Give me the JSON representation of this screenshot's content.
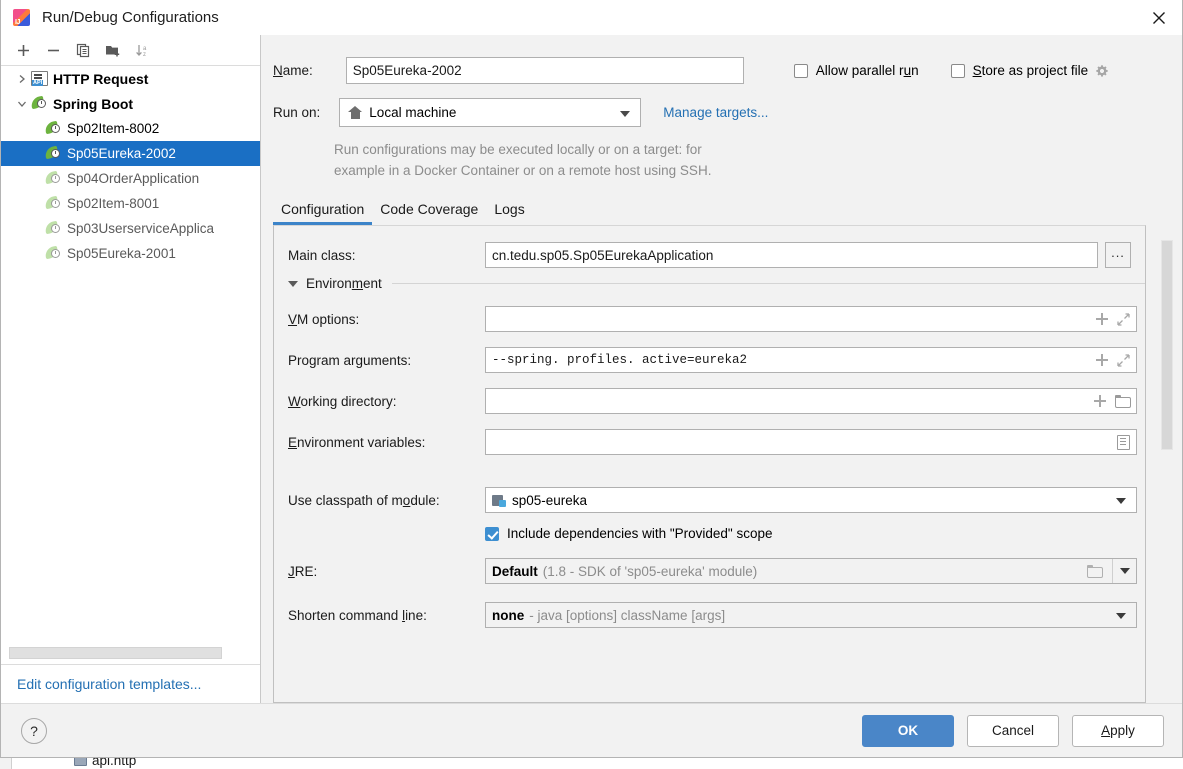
{
  "window": {
    "title": "Run/Debug Configurations",
    "app_icon": "intellij-idea-icon",
    "close_icon": "close-icon"
  },
  "sidebar": {
    "toolbar": [
      {
        "name": "add-configuration-button",
        "icon": "plus-icon"
      },
      {
        "name": "remove-configuration-button",
        "icon": "minus-icon"
      },
      {
        "name": "copy-configuration-button",
        "icon": "copy-icon"
      },
      {
        "name": "new-folder-button",
        "icon": "folder-add-icon"
      },
      {
        "name": "sort-configurations-button",
        "icon": "sort-alphabetical-icon"
      }
    ],
    "tree": [
      {
        "label": "HTTP Request",
        "type": "group",
        "expanded": false,
        "icon": "http-request-icon",
        "selected": false
      },
      {
        "label": "Spring Boot",
        "type": "group",
        "expanded": true,
        "icon": "spring-boot-icon",
        "selected": false
      },
      {
        "label": "Sp02Item-8002",
        "type": "item",
        "icon": "spring-boot-icon",
        "selected": false,
        "dim": false
      },
      {
        "label": "Sp05Eureka-2002",
        "type": "item",
        "icon": "spring-boot-icon",
        "selected": true,
        "dim": false
      },
      {
        "label": "Sp04OrderApplication",
        "type": "item",
        "icon": "spring-boot-icon",
        "selected": false,
        "dim": true
      },
      {
        "label": "Sp02Item-8001",
        "type": "item",
        "icon": "spring-boot-icon",
        "selected": false,
        "dim": true
      },
      {
        "label": "Sp03UserserviceApplica",
        "type": "item",
        "icon": "spring-boot-icon",
        "selected": false,
        "dim": true
      },
      {
        "label": "Sp05Eureka-2001",
        "type": "item",
        "icon": "spring-boot-icon",
        "selected": false,
        "dim": true
      }
    ],
    "edit_templates_link": "Edit configuration templates..."
  },
  "form": {
    "name_label": "Name:",
    "name_value": "Sp05Eureka-2002",
    "allow_parallel_run_label": "Allow parallel run",
    "allow_parallel_run_checked": false,
    "store_as_project_file_label": "Store as project file",
    "store_as_project_file_checked": false,
    "run_on_label": "Run on:",
    "run_on_value": "Local machine",
    "manage_targets_link": "Manage targets...",
    "hint_line1": "Run configurations may be executed locally or on a target: for",
    "hint_line2": "example in a Docker Container or on a remote host using SSH."
  },
  "tabs": [
    {
      "label": "Configuration",
      "active": true
    },
    {
      "label": "Code Coverage",
      "active": false
    },
    {
      "label": "Logs",
      "active": false
    }
  ],
  "configuration": {
    "main_class_label": "Main class:",
    "main_class_value": "cn.tedu.sp05.Sp05EurekaApplication",
    "browse_button_label": "...",
    "environment_section_label": "Environment",
    "vm_options_label": "VM options:",
    "vm_options_value": "",
    "program_arguments_label": "Program arguments:",
    "program_arguments_value": "--spring. profiles. active=eureka2",
    "working_directory_label": "Working directory:",
    "working_directory_value": "",
    "environment_variables_label": "Environment variables:",
    "environment_variables_value": "",
    "use_classpath_label": "Use classpath of module:",
    "use_classpath_value": "sp05-eureka",
    "include_provided_label": "Include dependencies with \"Provided\" scope",
    "include_provided_checked": true,
    "jre_label": "JRE:",
    "jre_value": "Default",
    "jre_detail": "(1.8 - SDK of 'sp05-eureka' module)",
    "shorten_label": "Shorten command line:",
    "shorten_value": "none",
    "shorten_detail": "- java [options] className [args]"
  },
  "footer": {
    "help_label": "?",
    "ok_label": "OK",
    "cancel_label": "Cancel",
    "apply_label": "Apply"
  },
  "background": {
    "item_label": "api.http"
  },
  "colors": {
    "selection_blue": "#1a6fc4",
    "link_blue": "#2470b3",
    "tab_underline": "#3c84c9",
    "primary_button": "#4a86c8",
    "checkbox_checked": "#3d8fd1",
    "spring_green": "#6db33f",
    "dialog_bg": "#f2f2f2"
  }
}
